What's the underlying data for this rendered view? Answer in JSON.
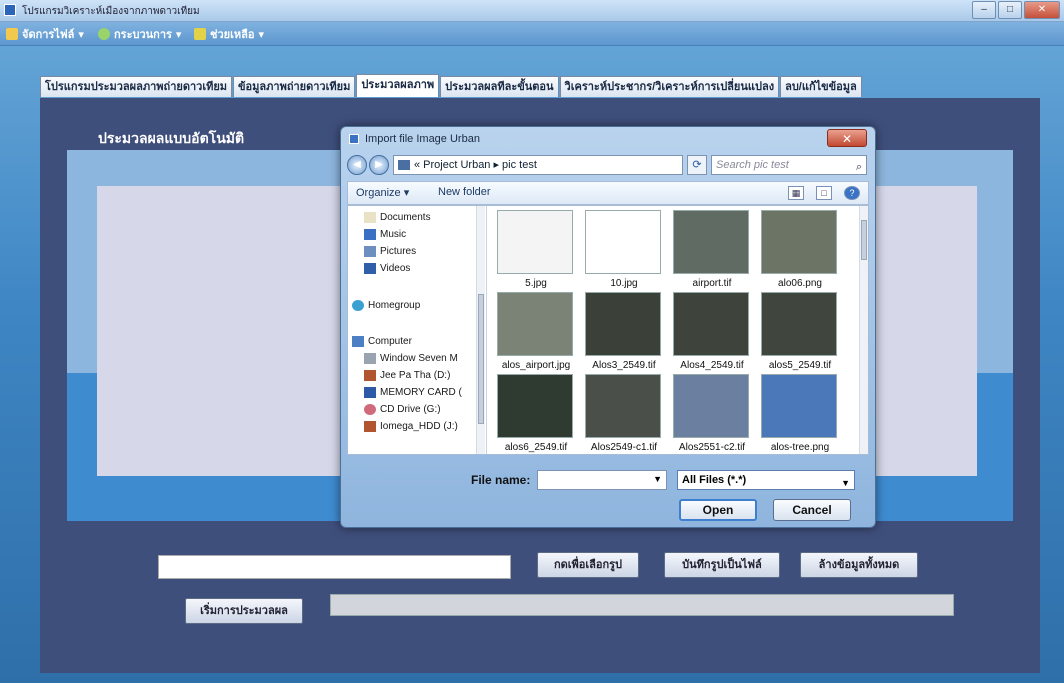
{
  "window": {
    "title": "โปรแกรมวิเคราะห์เมืองจากภาพดาวเทียม"
  },
  "menubar": [
    {
      "label": "จัดการไฟล์",
      "icon": "folder-icon"
    },
    {
      "label": "กระบวนการ",
      "icon": "gear-icon"
    },
    {
      "label": "ช่วยเหลือ",
      "icon": "help-icon"
    }
  ],
  "tabs": [
    {
      "label": "โปรแกรมประมวลผลภาพถ่ายดาวเทียม"
    },
    {
      "label": "ข้อมูลภาพถ่ายดาวเทียม"
    },
    {
      "label": "ประมวลผลภาพ",
      "active": true
    },
    {
      "label": "ประมวลผลทีละขั้นตอน"
    },
    {
      "label": "วิเคราะห์ประชากร/วิเคราะห์การเปลี่ยนแปลง"
    },
    {
      "label": "ลบ/แก้ไขข้อมูล"
    }
  ],
  "panel": {
    "heading": "ประมวลผลแบบอัตโนมัติ",
    "select_image_button": "กดเพื่อเลือกรูป",
    "save_image_button": "บันทึกรูปเป็นไฟล์",
    "clear_button": "ล้างข้อมูลทั้งหมด",
    "start_button": "เริ่มการประมวลผล"
  },
  "dialog": {
    "title": "Import file Image Urban",
    "close": "✕",
    "address": "« Project Urban ▸ pic test",
    "search_placeholder": "Search pic test",
    "organize": "Organize ▾",
    "new_folder": "New folder",
    "nav_items": [
      {
        "label": "Documents",
        "icon": "documents-icon"
      },
      {
        "label": "Music",
        "icon": "music-icon"
      },
      {
        "label": "Pictures",
        "icon": "pictures-icon"
      },
      {
        "label": "Videos",
        "icon": "videos-icon"
      },
      {
        "label": "Homegroup",
        "icon": "homegroup-icon"
      },
      {
        "label": "Computer",
        "icon": "computer-icon"
      },
      {
        "label": "Window Seven M",
        "icon": "drive-icon"
      },
      {
        "label": "Jee Pa Tha (D:)",
        "icon": "drive-icon"
      },
      {
        "label": "MEMORY CARD (",
        "icon": "memory-card-icon"
      },
      {
        "label": "CD Drive (G:)",
        "icon": "cd-drive-icon"
      },
      {
        "label": "Iomega_HDD (J:)",
        "icon": "drive-icon"
      }
    ],
    "files": [
      {
        "name": "5.jpg",
        "tone": "#f4f4f4"
      },
      {
        "name": "10.jpg",
        "tone": "#ffffff"
      },
      {
        "name": "airport.tif",
        "tone": "#5f6b63"
      },
      {
        "name": "alo06.png",
        "tone": "#6c7466"
      },
      {
        "name": "alos_airport.jpg",
        "tone": "#7b8377"
      },
      {
        "name": "Alos3_2549.tif",
        "tone": "#3b4038"
      },
      {
        "name": "Alos4_2549.tif",
        "tone": "#3e443c"
      },
      {
        "name": "alos5_2549.tif",
        "tone": "#40463e"
      },
      {
        "name": "alos6_2549.tif",
        "tone": "#2f3a30"
      },
      {
        "name": "Alos2549-c1.tif",
        "tone": "#4a4f4a"
      },
      {
        "name": "Alos2551-c2.tif",
        "tone": "#6b7fa0"
      },
      {
        "name": "alos-tree.png",
        "tone": "#4a78b8"
      }
    ],
    "file_name_label": "File name:",
    "file_name_value": "",
    "filter": "All Files (*.*)",
    "open_button": "Open",
    "cancel_button": "Cancel"
  }
}
